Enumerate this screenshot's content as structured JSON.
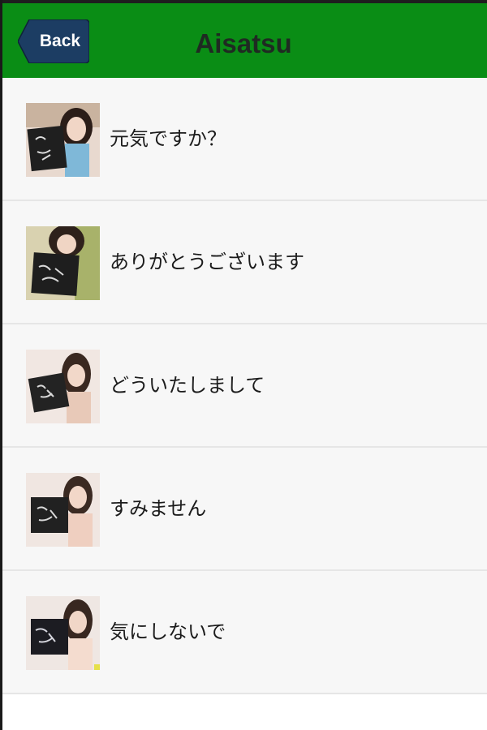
{
  "header": {
    "back_label": "Back",
    "title": "Aisatsu",
    "background_color": "#0a8d15",
    "back_button_color": "#1c3d63"
  },
  "items": [
    {
      "label": "元気ですか？",
      "thumbnail": "photo-girl-chalkboard"
    },
    {
      "label": "ありがとうございます",
      "thumbnail": "photo-girl-chalkboard"
    },
    {
      "label": "どういたしまして",
      "thumbnail": "photo-girl-chalkboard"
    },
    {
      "label": "すみません",
      "thumbnail": "photo-girl-chalkboard"
    },
    {
      "label": "気にしないで",
      "thumbnail": "photo-girl-chalkboard"
    }
  ]
}
